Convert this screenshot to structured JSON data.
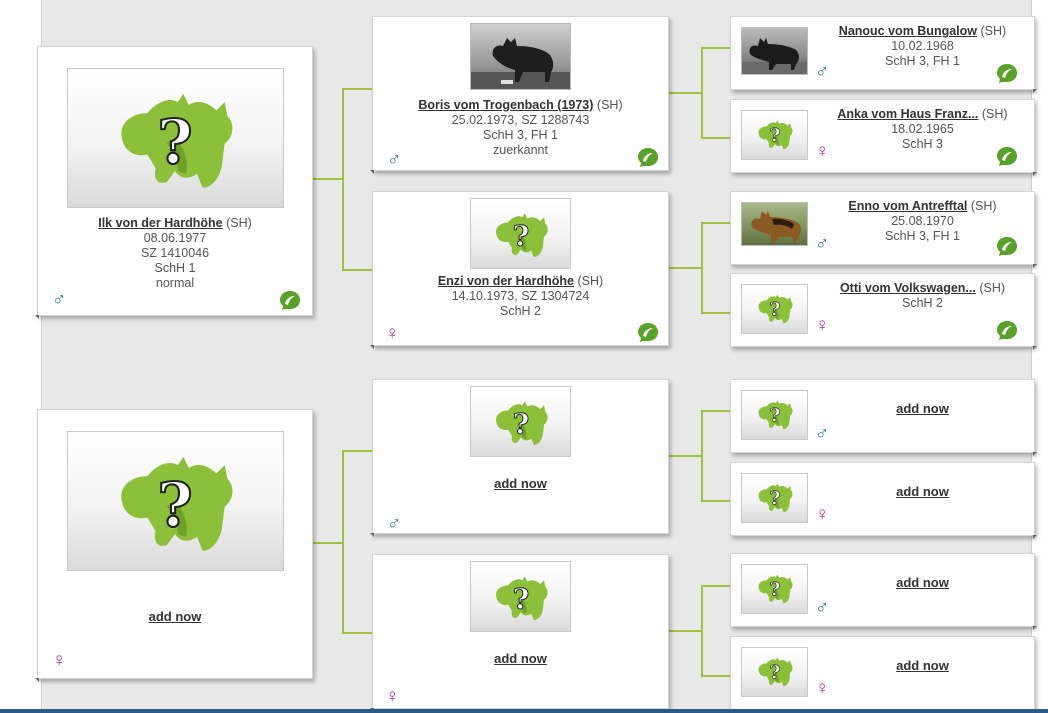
{
  "colors": {
    "accent": "#9ec23f",
    "male": "#2a7ab0",
    "female": "#b5329b"
  },
  "icons": {
    "male": "male-symbol-icon",
    "female": "female-symbol-icon",
    "leaf": "leaf-icon",
    "placeholder": "unknown-dog-placeholder-icon"
  },
  "symbols": {
    "male": "♂",
    "female": "♀"
  },
  "parent1": {
    "name": "Ilk von der Hardhöhe",
    "reg": "(SH)",
    "lines": [
      "08.06.1977",
      "SZ 1410046",
      "SchH 1",
      "normal"
    ]
  },
  "parent2": {
    "add": "add now"
  },
  "gp1": {
    "name": "Boris vom Trogenbach (1973)",
    "reg": "(SH)",
    "lines": [
      "25.02.1973, SZ 1288743",
      "SchH 3, FH 1",
      "zuerkannt"
    ]
  },
  "gp2": {
    "name": "Enzi von der Hardhöhe",
    "reg": "(SH)",
    "lines": [
      "14.10.1973, SZ 1304724",
      "SchH 2"
    ]
  },
  "gp3": {
    "add": "add now"
  },
  "gp4": {
    "add": "add now"
  },
  "ggp1": {
    "name": "Nanouc vom Bungalow",
    "reg": "(SH)",
    "lines": [
      "10.02.1968",
      "SchH 3, FH 1"
    ]
  },
  "ggp2": {
    "name": "Anka vom Haus Franz...",
    "reg": "(SH)",
    "lines": [
      "18.02.1965",
      "SchH 3"
    ]
  },
  "ggp3": {
    "name": "Enno vom Antrefftal",
    "reg": "(SH)",
    "lines": [
      "25.08.1970",
      "SchH 3, FH 1"
    ]
  },
  "ggp4": {
    "name": "Otti vom Volkswagen...",
    "reg": "(SH)",
    "lines": [
      "SchH 2"
    ]
  },
  "ggp5": {
    "add": "add now"
  },
  "ggp6": {
    "add": "add now"
  },
  "ggp7": {
    "add": "add now"
  },
  "ggp8": {
    "add": "add now"
  }
}
